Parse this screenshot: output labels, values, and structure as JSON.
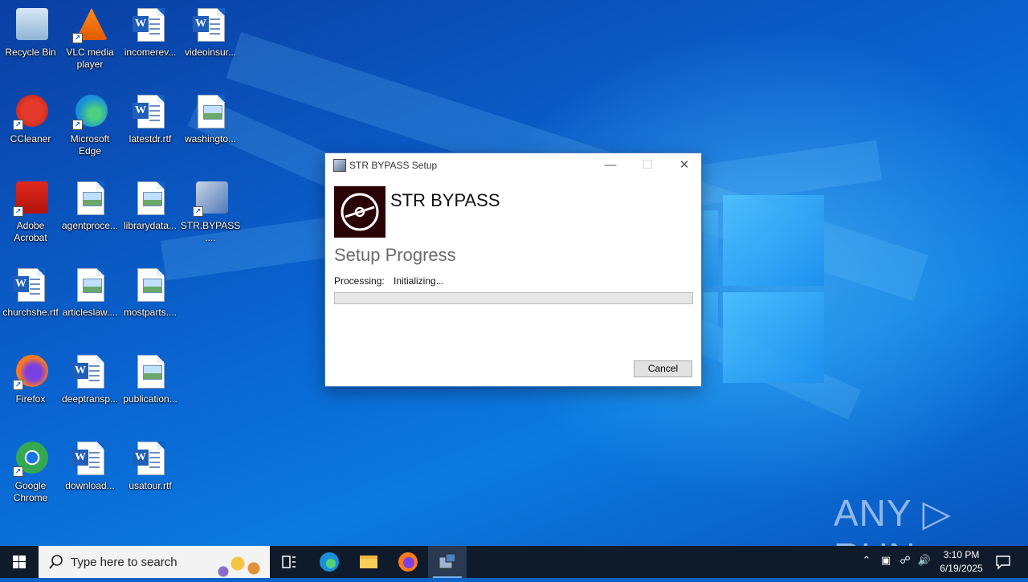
{
  "desktop": {
    "icons": [
      {
        "label": "Recycle Bin",
        "icon": "recycle-bin-icon"
      },
      {
        "label": "VLC media player",
        "icon": "vlc-icon"
      },
      {
        "label": "incomerev...",
        "icon": "word-doc-icon"
      },
      {
        "label": "videoinsur...",
        "icon": "word-doc-icon"
      },
      {
        "label": "CCleaner",
        "icon": "ccleaner-icon"
      },
      {
        "label": "Microsoft Edge",
        "icon": "edge-icon"
      },
      {
        "label": "latestdr.rtf",
        "icon": "word-doc-icon"
      },
      {
        "label": "washingto...",
        "icon": "image-file-icon"
      },
      {
        "label": "Adobe Acrobat",
        "icon": "acrobat-icon"
      },
      {
        "label": "agentproce...",
        "icon": "image-file-icon"
      },
      {
        "label": "librarydata...",
        "icon": "image-file-icon"
      },
      {
        "label": "STR.BYPASS....",
        "icon": "installer-icon"
      },
      {
        "label": "churchshe.rtf",
        "icon": "word-doc-icon"
      },
      {
        "label": "articleslaw....",
        "icon": "image-file-icon"
      },
      {
        "label": "mostparts....",
        "icon": "image-file-icon"
      },
      {
        "label": "Firefox",
        "icon": "firefox-icon"
      },
      {
        "label": "deeptransp...",
        "icon": "word-doc-icon"
      },
      {
        "label": "publication...",
        "icon": "image-file-icon"
      },
      {
        "label": "Google Chrome",
        "icon": "chrome-icon"
      },
      {
        "label": "download...",
        "icon": "word-doc-icon"
      },
      {
        "label": "usatour.rtf",
        "icon": "word-doc-icon"
      }
    ]
  },
  "dialog": {
    "title": "STR BYPASS Setup",
    "banner_title": "STR BYPASS",
    "heading": "Setup Progress",
    "processing_label": "Processing:",
    "processing_value": "Initializing...",
    "progress": 0,
    "cancel_label": "Cancel"
  },
  "watermark": "ANY ▷ RUN",
  "taskbar": {
    "search_placeholder": "Type here to search",
    "apps": [
      "task-view-icon",
      "edge-icon",
      "file-explorer-icon",
      "firefox-icon",
      "installer-icon"
    ],
    "time": "3:10 PM",
    "date": "6/19/2025"
  },
  "colors": {
    "accent": "#0a63c9",
    "taskbar": "#0f1b2b",
    "progress_fill": "#06b025"
  }
}
